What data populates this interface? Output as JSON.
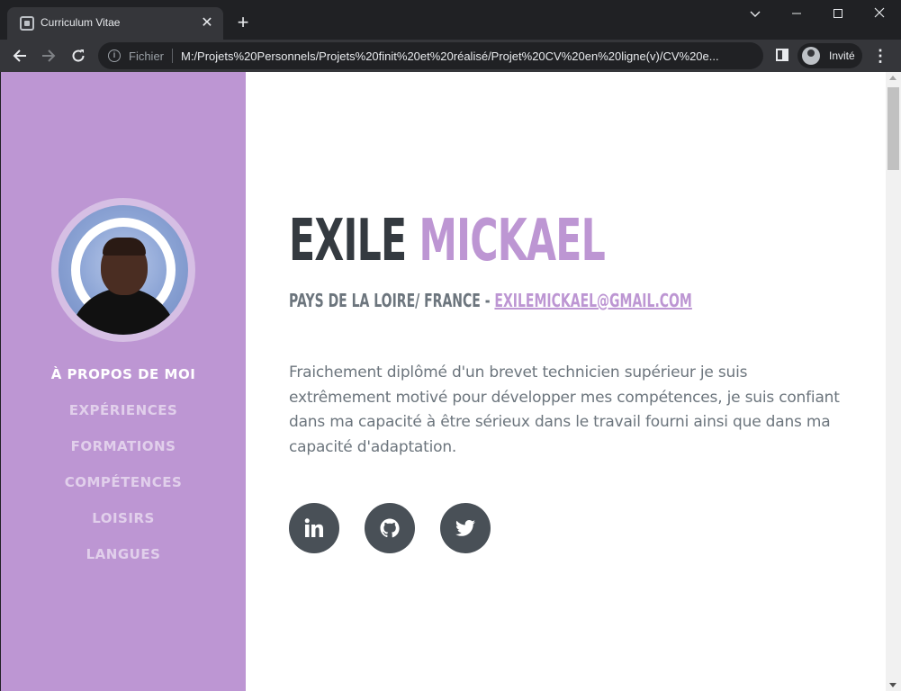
{
  "browser": {
    "tab_title": "Curriculum Vitae",
    "tab_close": "✕",
    "new_tab": "+",
    "omnibox_scheme": "Fichier",
    "url": "M:/Projets%20Personnels/Projets%20finit%20et%20réalisé/Projet%20CV%20en%20ligne(v)/CV%20e...",
    "profile_label": "Invité",
    "icons": [
      "favicon-icon",
      "close-icon",
      "plus-icon",
      "chevron-down-icon",
      "minimize-icon",
      "maximize-icon",
      "close-window-icon",
      "back-arrow-icon",
      "forward-arrow-icon",
      "reload-icon",
      "info-icon",
      "side-panel-icon",
      "profile-icon",
      "more-vertical-icon"
    ]
  },
  "sidebar": {
    "nav_items": [
      {
        "label": "À propos de moi",
        "active": true
      },
      {
        "label": "Expériences",
        "active": false
      },
      {
        "label": "Formations",
        "active": false
      },
      {
        "label": "Compétences",
        "active": false
      },
      {
        "label": "Loisirs",
        "active": false
      },
      {
        "label": "Langues",
        "active": false
      }
    ]
  },
  "main": {
    "first_name": "EXILE",
    "last_name": "MICKAEL",
    "location": "Pays de la Loire/ France - ",
    "email": "exilemickael@gmail.com",
    "lead": "Fraichement diplômé d'un brevet technicien supérieur je suis extrêmement motivé pour développer mes compétences, je suis confiant dans ma capacité à être sérieux dans le travail fourni ainsi que dans ma capacité d'adaptation.",
    "social": [
      {
        "name": "linkedin-icon"
      },
      {
        "name": "github-icon"
      },
      {
        "name": "twitter-icon"
      }
    ]
  },
  "colors": {
    "accent": "#bd96d3",
    "heading": "#343a40",
    "body_text": "#6c757d",
    "social_bg": "#495057",
    "chrome_dark": "#202124",
    "chrome_toolbar": "#35363a"
  }
}
